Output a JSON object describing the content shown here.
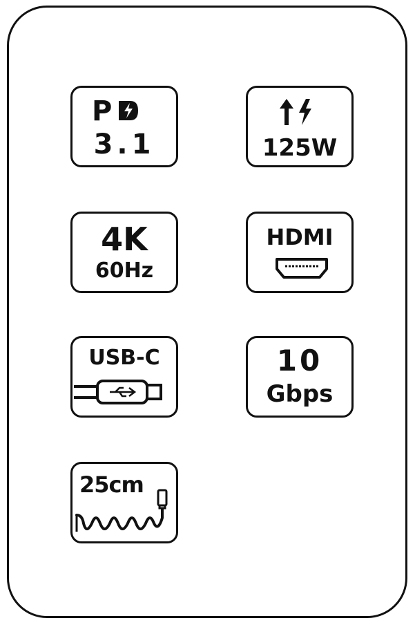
{
  "badges": {
    "pd": {
      "line1": "PD",
      "line2": "3.1",
      "icon": "lightning-bolt-icon"
    },
    "power": {
      "value": "125W",
      "icon": "up-arrow-lightning-icon"
    },
    "video": {
      "line1": "4K",
      "line2": "60Hz"
    },
    "hdmi": {
      "label": "HDMI",
      "icon": "hdmi-port-icon"
    },
    "usb": {
      "label": "USB-C",
      "icon": "usb-c-plug-icon"
    },
    "speed": {
      "line1": "10",
      "line2": "Gbps"
    },
    "length": {
      "value": "25cm",
      "icon": "coiled-cable-icon"
    }
  }
}
